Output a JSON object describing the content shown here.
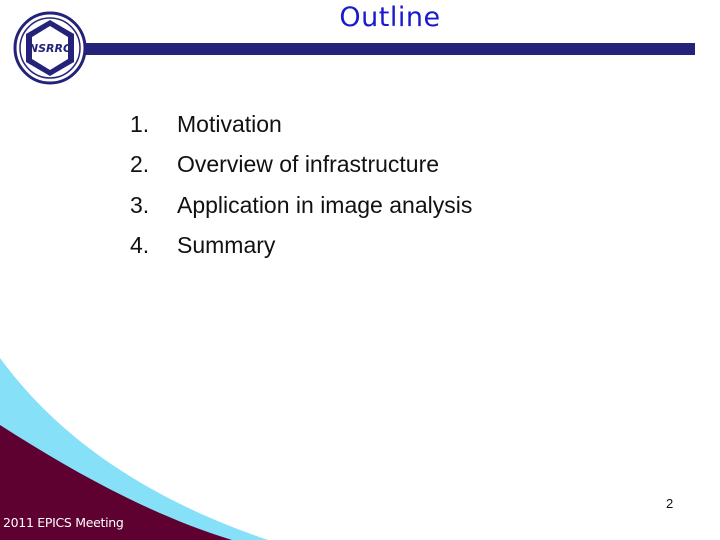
{
  "slide": {
    "title": "Outline",
    "logo_text": "NSRRC",
    "items": [
      {
        "number": "1.",
        "label": "Motivation"
      },
      {
        "number": "2.",
        "label": "Overview of infrastructure"
      },
      {
        "number": "3.",
        "label": "Application in image analysis"
      },
      {
        "number": "4.",
        "label": "Summary"
      }
    ],
    "footer": "2011 EPICS Meeting",
    "page_number": "2"
  },
  "colors": {
    "title": "#1a1acc",
    "title_bar": "#25227a",
    "swoosh_light": "#86e0f8",
    "swoosh_dark": "#5e0030"
  }
}
